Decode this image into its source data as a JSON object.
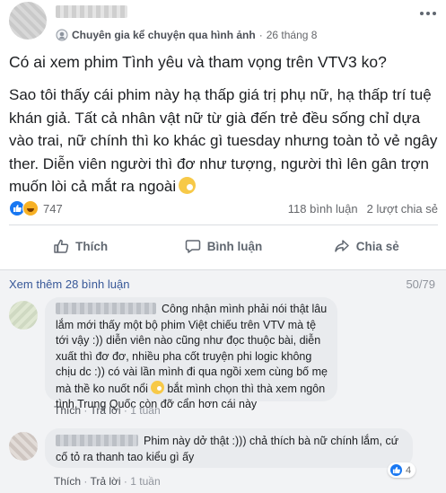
{
  "post": {
    "group_label": "Chuyên gia kể chuyện qua hình ảnh",
    "separator": "·",
    "date": "26 tháng 8",
    "question": "Có ai xem phim Tình yêu và tham vọng trên VTV3 ko?",
    "body": "Sao tôi thấy cái phim này hạ thấp giá trị phụ nữ, hạ thấp trí tuệ khán giả. Tất cả nhân vật nữ từ già đến trẻ đều sống chỉ dựa vào trai, nữ chính thì ko khác gì tuesday nhưng toàn tỏ vẻ ngây ther. Diễn viên người thì đơ như tượng, người thì lên gân trợn muốn lòi cả mắt ra ngoài",
    "reaction_count": "747",
    "comment_count": "118 bình luận",
    "share_count": "2 lượt chia sẻ"
  },
  "actions": {
    "like": "Thích",
    "comment": "Bình luận",
    "share": "Chia sẻ"
  },
  "comments_section": {
    "see_more": "Xem thêm 28 bình luận",
    "progress": "50/79",
    "items": [
      {
        "text_a": "Công nhận mình phải nói thật lâu lắm mới thấy một bộ phim Việt chiếu trên VTV mà tệ tới vậy :)) diễn viên nào cũng như đọc thuộc bài, diễn xuất thì đơ đơ, nhiều pha cốt truyện phi logic không chịu dc :)) có vài lần mình đi qua ngồi xem cùng bố mẹ mà thề ko nuốt nổi",
        "text_b": "bắt mình chọn thì thà xem ngôn tình Trung Quốc còn đỡ cẩn hơn cái này",
        "like": "Thích",
        "reply": "Trả lời",
        "sep": "·",
        "time": "1 tuần"
      },
      {
        "text": "Phim này dở thật :))) chả thích bà nữ chính lắm, cứ cố tỏ ra thanh tao kiểu gì ấy",
        "like": "Thích",
        "reply": "Trả lời",
        "sep": "·",
        "time": "1 tuần",
        "reaction_count": "4"
      }
    ]
  },
  "colors": {
    "link": "#385898",
    "like_blue": "#1877f2",
    "muted": "#90949c",
    "bubble": "#e9ebee"
  }
}
